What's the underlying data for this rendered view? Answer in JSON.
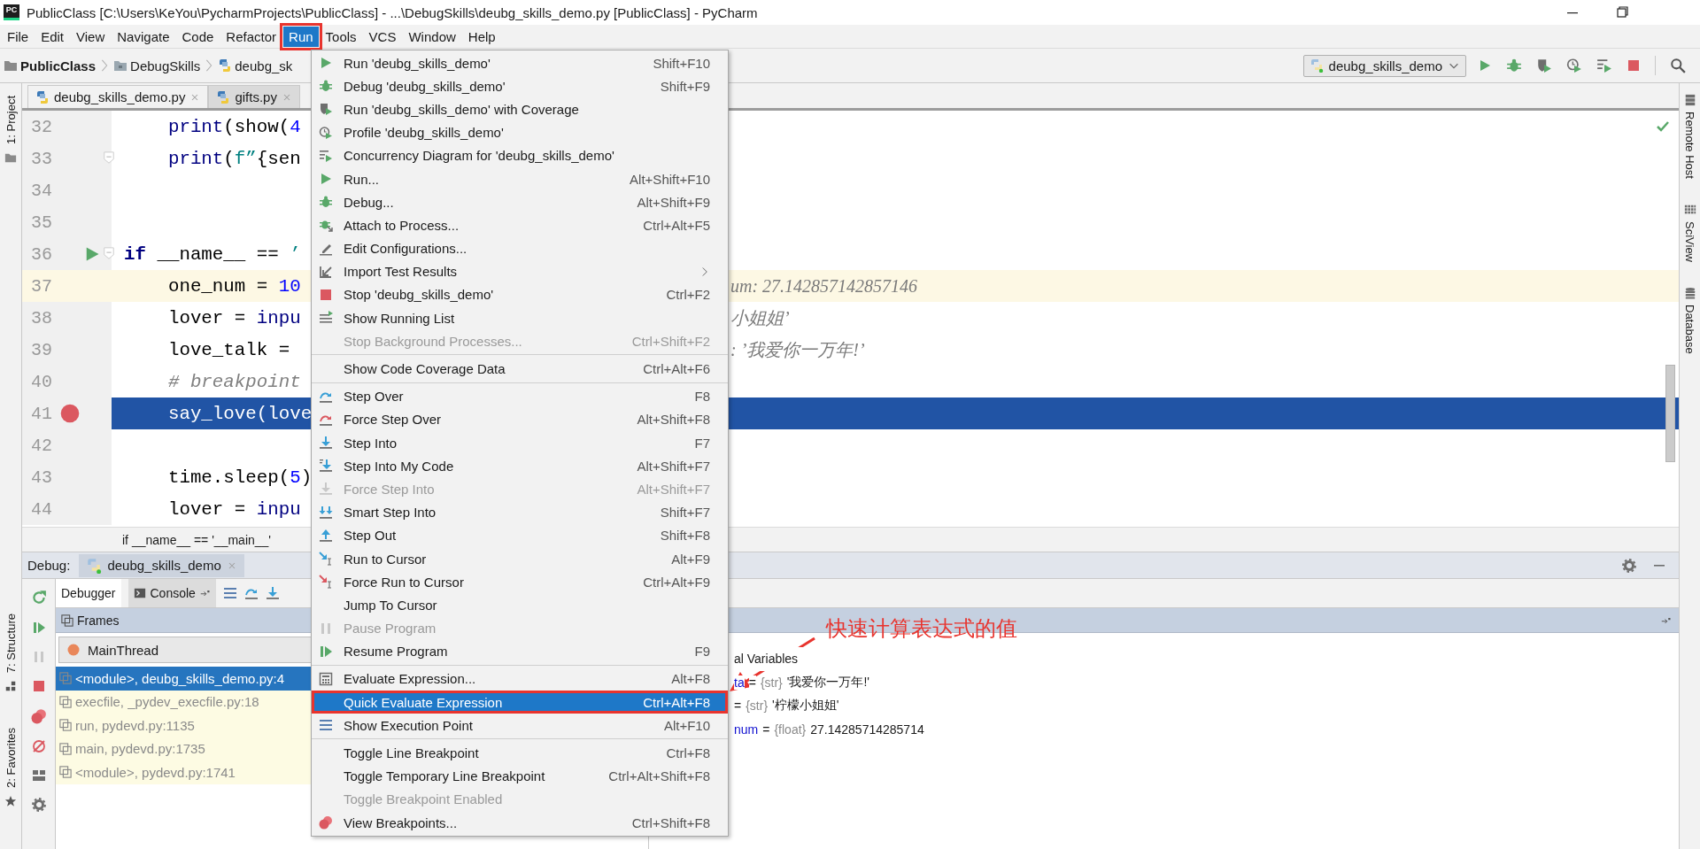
{
  "window": {
    "logo": "PC",
    "title": "PublicClass [C:\\Users\\KeYou\\PycharmProjects\\PublicClass] - ...\\DebugSkills\\deubg_skills_demo.py [PublicClass] - PyCharm"
  },
  "menu_bar": [
    {
      "label": "File",
      "selected": false,
      "outlined": false
    },
    {
      "label": "Edit",
      "selected": false,
      "outlined": false
    },
    {
      "label": "View",
      "selected": false,
      "outlined": false
    },
    {
      "label": "Navigate",
      "selected": false,
      "outlined": false
    },
    {
      "label": "Code",
      "selected": false,
      "outlined": false
    },
    {
      "label": "Refactor",
      "selected": false,
      "outlined": false
    },
    {
      "label": "Run",
      "selected": true,
      "outlined": true
    },
    {
      "label": "Tools",
      "selected": false,
      "outlined": false
    },
    {
      "label": "VCS",
      "selected": false,
      "outlined": false
    },
    {
      "label": "Window",
      "selected": false,
      "outlined": false
    },
    {
      "label": "Help",
      "selected": false,
      "outlined": false
    }
  ],
  "navigation_bar": {
    "breadcrumbs": [
      "PublicClass",
      "DebugSkills",
      "deubg_sk"
    ],
    "run_configuration": "deubg_skills_demo"
  },
  "left_tool_stripe": [
    "1: Project",
    "7: Structure",
    "2: Favorites"
  ],
  "right_tool_stripe": [
    "Remote Host",
    "SciView",
    "Database"
  ],
  "editor_tabs": [
    {
      "label": "deubg_skills_demo.py",
      "selected": true
    },
    {
      "label": "gifts.py",
      "selected": false
    }
  ],
  "editor": {
    "lines": [
      {
        "number": "32",
        "caret_line": false,
        "execution_point": false,
        "breakpoint": false,
        "run_marker": false,
        "fold": false,
        "tokens": [
          {
            "text": "    print",
            "kind": "builtin"
          },
          {
            "text": "(show(",
            "kind": "plain"
          },
          {
            "text": "4",
            "kind": "number"
          }
        ]
      },
      {
        "number": "33",
        "caret_line": false,
        "execution_point": false,
        "breakpoint": false,
        "run_marker": false,
        "fold": true,
        "tokens": [
          {
            "text": "    print",
            "kind": "builtin"
          },
          {
            "text": "(",
            "kind": "plain"
          },
          {
            "text": "f”",
            "kind": "string"
          },
          {
            "text": "{sen",
            "kind": "plain"
          }
        ]
      },
      {
        "number": "34",
        "caret_line": false,
        "execution_point": false,
        "breakpoint": false,
        "run_marker": false,
        "fold": false
      },
      {
        "number": "35",
        "caret_line": false,
        "execution_point": false,
        "breakpoint": false,
        "run_marker": false,
        "fold": false
      },
      {
        "number": "36",
        "caret_line": false,
        "execution_point": false,
        "breakpoint": false,
        "run_marker": true,
        "fold": true,
        "tokens": [
          {
            "text": "if",
            "kind": "keyword"
          },
          {
            "text": " __name__ == ",
            "kind": "plain"
          },
          {
            "text": "’",
            "kind": "string"
          }
        ]
      },
      {
        "number": "37",
        "caret_line": true,
        "execution_point": false,
        "breakpoint": false,
        "run_marker": false,
        "fold": false,
        "tokens": [
          {
            "text": "    one_num = ",
            "kind": "plain"
          },
          {
            "text": "10",
            "kind": "number"
          }
        ],
        "inline_value": "um: 27.142857142857146"
      },
      {
        "number": "38",
        "caret_line": false,
        "execution_point": false,
        "breakpoint": false,
        "run_marker": false,
        "fold": false,
        "tokens": [
          {
            "text": "    lover = ",
            "kind": "plain"
          },
          {
            "text": "inpu",
            "kind": "builtin"
          }
        ],
        "inline_value": "小姐姐’"
      },
      {
        "number": "39",
        "caret_line": false,
        "execution_point": false,
        "breakpoint": false,
        "run_marker": false,
        "fold": false,
        "tokens": [
          {
            "text": "    love_talk = ",
            "kind": "plain"
          }
        ],
        "inline_value": ": ’我爱你一万年!’"
      },
      {
        "number": "40",
        "caret_line": false,
        "execution_point": false,
        "breakpoint": false,
        "run_marker": false,
        "fold": false,
        "tokens": [
          {
            "text": "    # breakpoint",
            "kind": "comment"
          }
        ]
      },
      {
        "number": "41",
        "caret_line": false,
        "execution_point": true,
        "breakpoint": true,
        "run_marker": false,
        "fold": false,
        "tokens": [
          {
            "text": "    say_love(love",
            "kind": "plain"
          }
        ]
      },
      {
        "number": "42",
        "caret_line": false,
        "execution_point": false,
        "breakpoint": false,
        "run_marker": false,
        "fold": false
      },
      {
        "number": "43",
        "caret_line": false,
        "execution_point": false,
        "breakpoint": false,
        "run_marker": false,
        "fold": false,
        "tokens": [
          {
            "text": "    time.sleep(",
            "kind": "plain"
          },
          {
            "text": "5",
            "kind": "number"
          },
          {
            "text": ")",
            "kind": "plain"
          }
        ]
      },
      {
        "number": "44",
        "caret_line": false,
        "execution_point": false,
        "breakpoint": false,
        "run_marker": false,
        "fold": false,
        "tokens": [
          {
            "text": "    lover = ",
            "kind": "plain"
          },
          {
            "text": "inpu",
            "kind": "builtin"
          }
        ]
      }
    ],
    "breadcrumb": "if __name__ == '__main__'"
  },
  "debug_panel": {
    "title": "Debug:",
    "session_tab": "deubg_skills_demo",
    "tabs": [
      {
        "label": "Debugger",
        "selected": true
      },
      {
        "label": "Console",
        "selected": false
      }
    ],
    "frames_header": "Frames",
    "thread": "MainThread",
    "frames": [
      {
        "text": "<module>, deubg_skills_demo.py:4",
        "selected": true,
        "kind": "user"
      },
      {
        "text": "execfile, _pydev_execfile.py:18",
        "selected": false,
        "kind": "library"
      },
      {
        "text": "run, pydevd.py:1135",
        "selected": false,
        "kind": "library"
      },
      {
        "text": "main, pydevd.py:1735",
        "selected": false,
        "kind": "library"
      },
      {
        "text": "<module>, pydevd.py:1741",
        "selected": false,
        "kind": "library"
      }
    ],
    "variables_header": "al Variables",
    "variables": [
      {
        "name": "ta",
        "assign": "=",
        "type": "{str}",
        "value": "'我爱你一万年!'"
      },
      {
        "assign": "=",
        "type": "{str}",
        "value": "'柠檬小姐姐'"
      },
      {
        "name": "num",
        "assign": "=",
        "type": "{float}",
        "value": "27.14285714285714"
      }
    ]
  },
  "run_menu": {
    "items": [
      {
        "kind": "item",
        "label": "Run 'deubg_skills_demo'",
        "shortcut": "Shift+F10",
        "disabled": false,
        "selected": false,
        "outlined": false,
        "submenu": false
      },
      {
        "kind": "item",
        "label": "Debug 'deubg_skills_demo'",
        "shortcut": "Shift+F9",
        "disabled": false,
        "selected": false,
        "outlined": false,
        "submenu": false
      },
      {
        "kind": "item",
        "label": "Run 'deubg_skills_demo' with Coverage",
        "disabled": false,
        "selected": false,
        "outlined": false,
        "submenu": false
      },
      {
        "kind": "item",
        "label": "Profile 'deubg_skills_demo'",
        "disabled": false,
        "selected": false,
        "outlined": false,
        "submenu": false
      },
      {
        "kind": "item",
        "label": "Concurrency Diagram for 'deubg_skills_demo'",
        "disabled": false,
        "selected": false,
        "outlined": false,
        "submenu": false
      },
      {
        "kind": "item",
        "label": "Run...",
        "shortcut": "Alt+Shift+F10",
        "disabled": false,
        "selected": false,
        "outlined": false,
        "submenu": false
      },
      {
        "kind": "item",
        "label": "Debug...",
        "shortcut": "Alt+Shift+F9",
        "disabled": false,
        "selected": false,
        "outlined": false,
        "submenu": false
      },
      {
        "kind": "item",
        "label": "Attach to Process...",
        "shortcut": "Ctrl+Alt+F5",
        "disabled": false,
        "selected": false,
        "outlined": false,
        "submenu": false
      },
      {
        "kind": "item",
        "label": "Edit Configurations...",
        "disabled": false,
        "selected": false,
        "outlined": false,
        "submenu": false
      },
      {
        "kind": "item",
        "label": "Import Test Results",
        "disabled": false,
        "selected": false,
        "outlined": false,
        "submenu": true
      },
      {
        "kind": "item",
        "label": "Stop 'deubg_skills_demo'",
        "shortcut": "Ctrl+F2",
        "disabled": false,
        "selected": false,
        "outlined": false,
        "submenu": false
      },
      {
        "kind": "item",
        "label": "Show Running List",
        "disabled": false,
        "selected": false,
        "outlined": false,
        "submenu": false
      },
      {
        "kind": "item",
        "label": "Stop Background Processes...",
        "shortcut": "Ctrl+Shift+F2",
        "disabled": true,
        "selected": false,
        "outlined": false,
        "submenu": false
      },
      {
        "kind": "separator"
      },
      {
        "kind": "item",
        "label": "Show Code Coverage Data",
        "shortcut": "Ctrl+Alt+F6",
        "disabled": false,
        "selected": false,
        "outlined": false,
        "submenu": false
      },
      {
        "kind": "separator"
      },
      {
        "kind": "item",
        "label": "Step Over",
        "shortcut": "F8",
        "disabled": false,
        "selected": false,
        "outlined": false,
        "submenu": false
      },
      {
        "kind": "item",
        "label": "Force Step Over",
        "shortcut": "Alt+Shift+F8",
        "disabled": false,
        "selected": false,
        "outlined": false,
        "submenu": false
      },
      {
        "kind": "item",
        "label": "Step Into",
        "shortcut": "F7",
        "disabled": false,
        "selected": false,
        "outlined": false,
        "submenu": false
      },
      {
        "kind": "item",
        "label": "Step Into My Code",
        "shortcut": "Alt+Shift+F7",
        "disabled": false,
        "selected": false,
        "outlined": false,
        "submenu": false
      },
      {
        "kind": "item",
        "label": "Force Step Into",
        "shortcut": "Alt+Shift+F7",
        "disabled": true,
        "selected": false,
        "outlined": false,
        "submenu": false
      },
      {
        "kind": "item",
        "label": "Smart Step Into",
        "shortcut": "Shift+F7",
        "disabled": false,
        "selected": false,
        "outlined": false,
        "submenu": false
      },
      {
        "kind": "item",
        "label": "Step Out",
        "shortcut": "Shift+F8",
        "disabled": false,
        "selected": false,
        "outlined": false,
        "submenu": false
      },
      {
        "kind": "item",
        "label": "Run to Cursor",
        "shortcut": "Alt+F9",
        "disabled": false,
        "selected": false,
        "outlined": false,
        "submenu": false
      },
      {
        "kind": "item",
        "label": "Force Run to Cursor",
        "shortcut": "Ctrl+Alt+F9",
        "disabled": false,
        "selected": false,
        "outlined": false,
        "submenu": false
      },
      {
        "kind": "item",
        "label": "Jump To Cursor",
        "disabled": false,
        "selected": false,
        "outlined": false,
        "submenu": false
      },
      {
        "kind": "item",
        "label": "Pause Program",
        "disabled": true,
        "selected": false,
        "outlined": false,
        "submenu": false
      },
      {
        "kind": "item",
        "label": "Resume Program",
        "shortcut": "F9",
        "disabled": false,
        "selected": false,
        "outlined": false,
        "submenu": false
      },
      {
        "kind": "separator"
      },
      {
        "kind": "item",
        "label": "Evaluate Expression...",
        "shortcut": "Alt+F8",
        "disabled": false,
        "selected": false,
        "outlined": false,
        "submenu": false
      },
      {
        "kind": "item",
        "label": "Quick Evaluate Expression",
        "shortcut": "Ctrl+Alt+F8",
        "disabled": false,
        "selected": true,
        "outlined": true,
        "submenu": false
      },
      {
        "kind": "item",
        "label": "Show Execution Point",
        "shortcut": "Alt+F10",
        "disabled": false,
        "selected": false,
        "outlined": false,
        "submenu": false
      },
      {
        "kind": "separator"
      },
      {
        "kind": "item",
        "label": "Toggle Line Breakpoint",
        "shortcut": "Ctrl+F8",
        "disabled": false,
        "selected": false,
        "outlined": false,
        "submenu": false
      },
      {
        "kind": "item",
        "label": "Toggle Temporary Line Breakpoint",
        "shortcut": "Ctrl+Alt+Shift+F8",
        "disabled": false,
        "selected": false,
        "outlined": false,
        "submenu": false
      },
      {
        "kind": "item",
        "label": "Toggle Breakpoint Enabled",
        "disabled": true,
        "selected": false,
        "outlined": false,
        "submenu": false
      },
      {
        "kind": "item",
        "label": "View Breakpoints...",
        "shortcut": "Ctrl+Shift+F8",
        "disabled": false,
        "selected": false,
        "outlined": false,
        "submenu": false
      }
    ]
  },
  "annotation": {
    "text": "快速计算表达式的值"
  }
}
